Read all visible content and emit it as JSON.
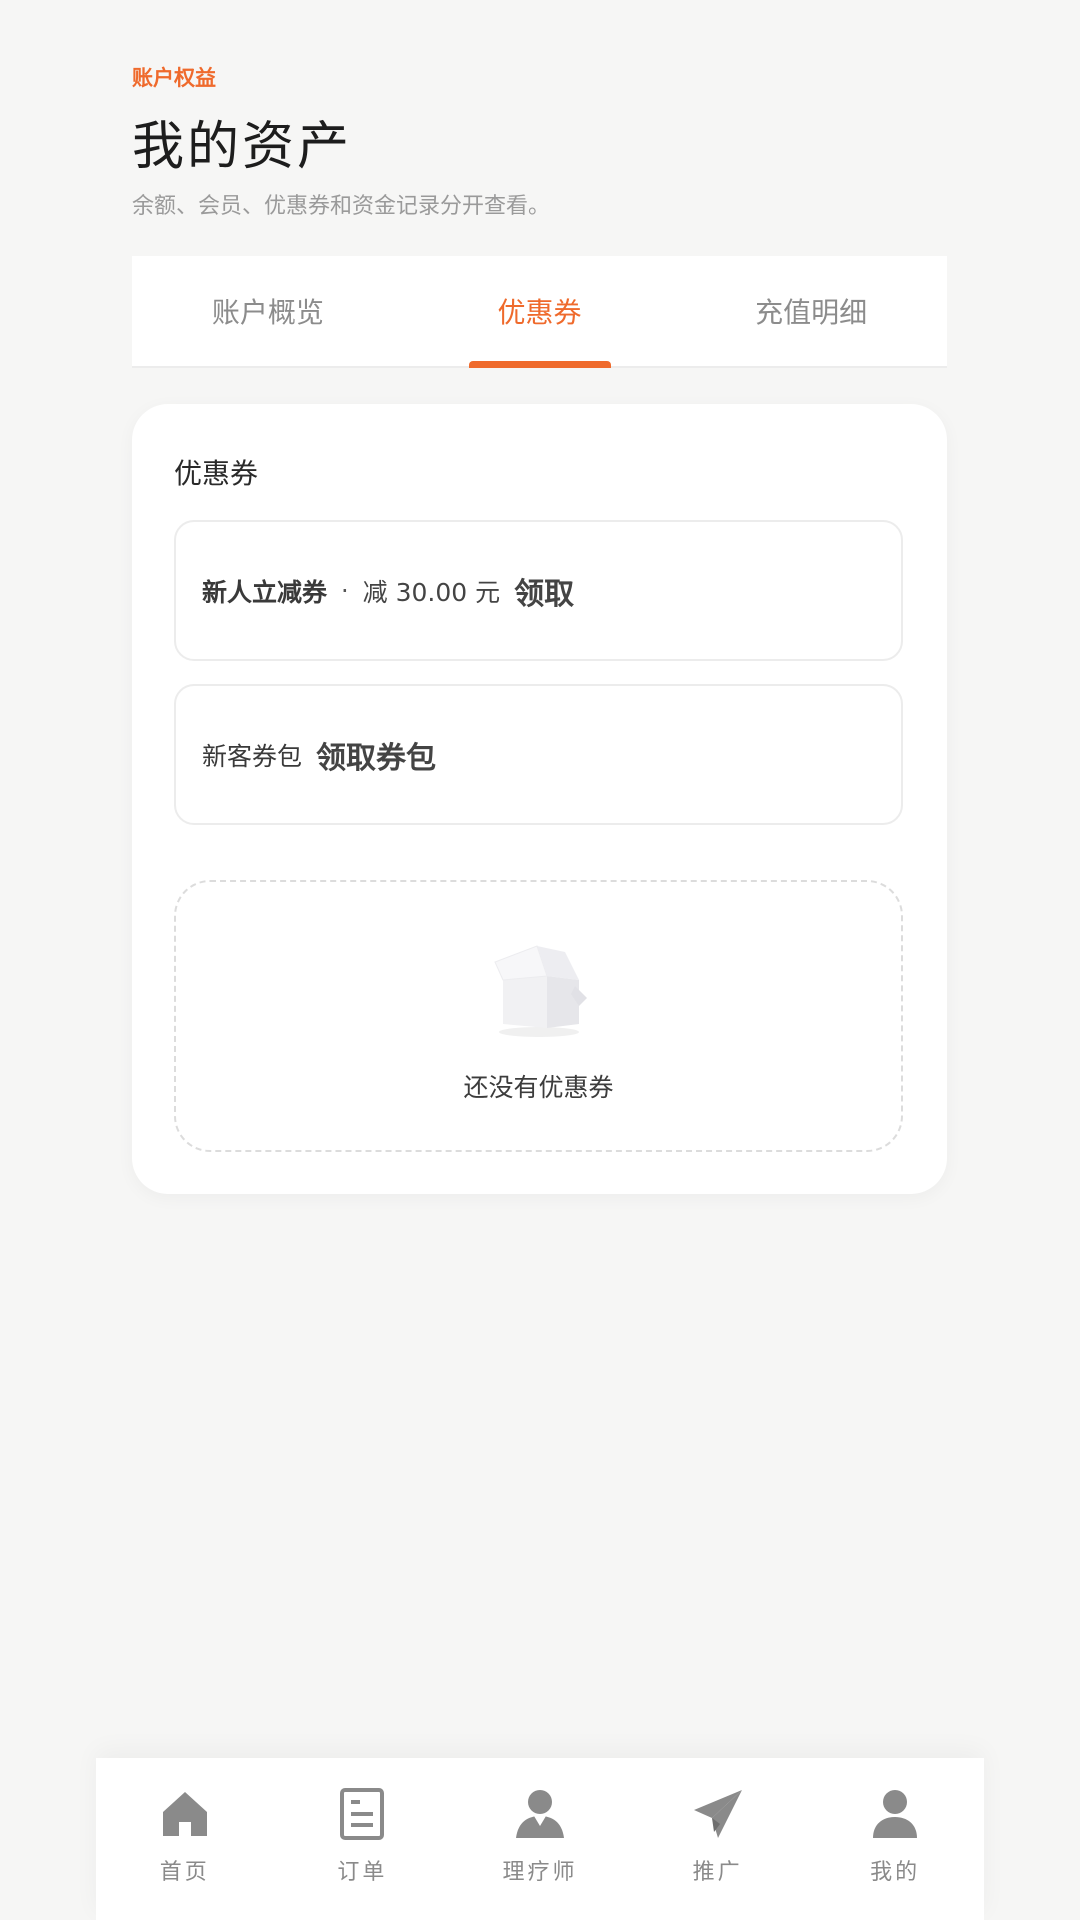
{
  "header": {
    "eyebrow": "账户权益",
    "title": "我的资产",
    "subtitle": "余额、会员、优惠券和资金记录分开查看。"
  },
  "tabs": [
    {
      "label": "账户概览",
      "active": false
    },
    {
      "label": "优惠券",
      "active": true
    },
    {
      "label": "充值明细",
      "active": false
    }
  ],
  "coupon_card": {
    "title": "优惠券",
    "items": [
      {
        "name": "新人立减券",
        "separator": "·",
        "amount": "减 30.00 元",
        "action": "领取"
      },
      {
        "name": "新客券包",
        "action": "领取券包"
      }
    ],
    "empty_text": "还没有优惠券",
    "empty_icon": "empty-box-icon"
  },
  "bottom_nav": [
    {
      "label": "首页",
      "icon": "home-icon"
    },
    {
      "label": "订单",
      "icon": "order-icon"
    },
    {
      "label": "理疗师",
      "icon": "therapist-icon"
    },
    {
      "label": "推广",
      "icon": "paper-plane-icon"
    },
    {
      "label": "我的",
      "icon": "user-icon"
    }
  ],
  "colors": {
    "accent": "#ef6a2c",
    "background": "#f6f6f5",
    "nav_icon": "#8a8a8a"
  }
}
